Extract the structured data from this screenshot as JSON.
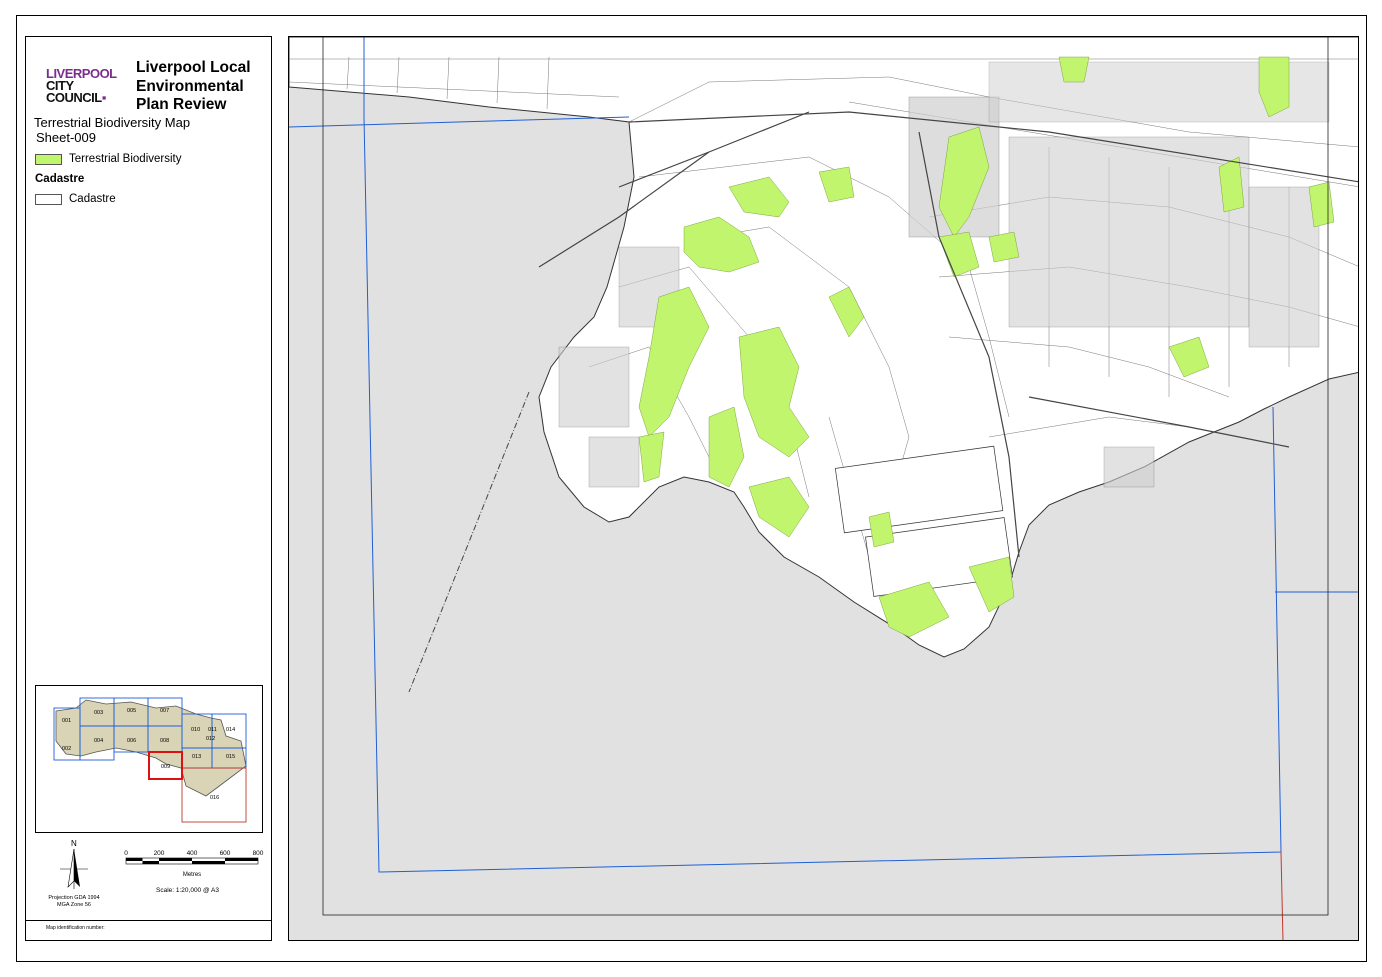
{
  "legend": {
    "logo": {
      "line1": "LIVERPOOL",
      "line2": "CITY",
      "line3": "COUNCIL"
    },
    "title": "Liverpool Local Environmental Plan Review",
    "map_name": "Terrestrial Biodiversity Map",
    "sheet": "Sheet-009",
    "items": [
      {
        "label": "Terrestrial Biodiversity",
        "color": "#c2f56e"
      }
    ],
    "cadastre_heading": "Cadastre",
    "cadastre_item": {
      "label": "Cadastre",
      "color": "#ffffff"
    }
  },
  "inset": {
    "sheet_labels": [
      "001",
      "002",
      "003",
      "004",
      "005",
      "006",
      "007",
      "008",
      "009",
      "010",
      "011",
      "012",
      "013",
      "014",
      "015",
      "016"
    ],
    "current_sheet": "009"
  },
  "north_arrow": {
    "letter": "N"
  },
  "scale": {
    "ticks": [
      "0",
      "200",
      "400",
      "600",
      "800"
    ],
    "unit": "Metres",
    "text": "Scale: 1:20,000 @ A3"
  },
  "projection": {
    "line1": "Projection GDA 1994",
    "line2": "MGA Zone 56"
  },
  "map_identification": "Map identification number:",
  "colors": {
    "biodiversity": "#c2f56e",
    "water_background": "#e1e1e1",
    "grid_line": "#1f5fd6",
    "red_line": "#c0392b",
    "logo_purple": "#7b2d8e"
  }
}
